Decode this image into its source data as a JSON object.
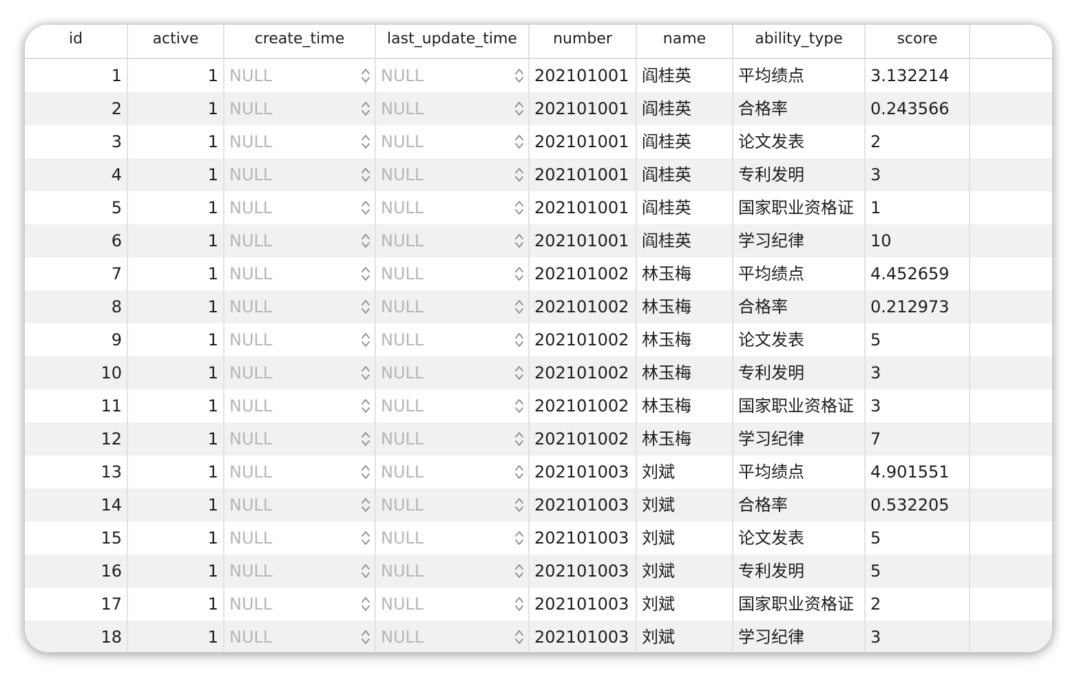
{
  "table": {
    "columns": [
      "id",
      "active",
      "create_time",
      "last_update_time",
      "number",
      "name",
      "ability_type",
      "score"
    ],
    "rows": [
      {
        "id": "1",
        "active": "1",
        "create_time": "NULL",
        "last_update_time": "NULL",
        "number": "202101001",
        "name": "阎桂英",
        "ability_type": "平均绩点",
        "score": "3.132214"
      },
      {
        "id": "2",
        "active": "1",
        "create_time": "NULL",
        "last_update_time": "NULL",
        "number": "202101001",
        "name": "阎桂英",
        "ability_type": "合格率",
        "score": "0.243566"
      },
      {
        "id": "3",
        "active": "1",
        "create_time": "NULL",
        "last_update_time": "NULL",
        "number": "202101001",
        "name": "阎桂英",
        "ability_type": "论文发表",
        "score": "2"
      },
      {
        "id": "4",
        "active": "1",
        "create_time": "NULL",
        "last_update_time": "NULL",
        "number": "202101001",
        "name": "阎桂英",
        "ability_type": "专利发明",
        "score": "3"
      },
      {
        "id": "5",
        "active": "1",
        "create_time": "NULL",
        "last_update_time": "NULL",
        "number": "202101001",
        "name": "阎桂英",
        "ability_type": "国家职业资格证",
        "score": "1"
      },
      {
        "id": "6",
        "active": "1",
        "create_time": "NULL",
        "last_update_time": "NULL",
        "number": "202101001",
        "name": "阎桂英",
        "ability_type": "学习纪律",
        "score": "10"
      },
      {
        "id": "7",
        "active": "1",
        "create_time": "NULL",
        "last_update_time": "NULL",
        "number": "202101002",
        "name": "林玉梅",
        "ability_type": "平均绩点",
        "score": "4.452659"
      },
      {
        "id": "8",
        "active": "1",
        "create_time": "NULL",
        "last_update_time": "NULL",
        "number": "202101002",
        "name": "林玉梅",
        "ability_type": "合格率",
        "score": "0.212973"
      },
      {
        "id": "9",
        "active": "1",
        "create_time": "NULL",
        "last_update_time": "NULL",
        "number": "202101002",
        "name": "林玉梅",
        "ability_type": "论文发表",
        "score": "5"
      },
      {
        "id": "10",
        "active": "1",
        "create_time": "NULL",
        "last_update_time": "NULL",
        "number": "202101002",
        "name": "林玉梅",
        "ability_type": "专利发明",
        "score": "3"
      },
      {
        "id": "11",
        "active": "1",
        "create_time": "NULL",
        "last_update_time": "NULL",
        "number": "202101002",
        "name": "林玉梅",
        "ability_type": "国家职业资格证",
        "score": "3"
      },
      {
        "id": "12",
        "active": "1",
        "create_time": "NULL",
        "last_update_time": "NULL",
        "number": "202101002",
        "name": "林玉梅",
        "ability_type": "学习纪律",
        "score": "7"
      },
      {
        "id": "13",
        "active": "1",
        "create_time": "NULL",
        "last_update_time": "NULL",
        "number": "202101003",
        "name": "刘斌",
        "ability_type": "平均绩点",
        "score": "4.901551"
      },
      {
        "id": "14",
        "active": "1",
        "create_time": "NULL",
        "last_update_time": "NULL",
        "number": "202101003",
        "name": "刘斌",
        "ability_type": "合格率",
        "score": "0.532205"
      },
      {
        "id": "15",
        "active": "1",
        "create_time": "NULL",
        "last_update_time": "NULL",
        "number": "202101003",
        "name": "刘斌",
        "ability_type": "论文发表",
        "score": "5"
      },
      {
        "id": "16",
        "active": "1",
        "create_time": "NULL",
        "last_update_time": "NULL",
        "number": "202101003",
        "name": "刘斌",
        "ability_type": "专利发明",
        "score": "5"
      },
      {
        "id": "17",
        "active": "1",
        "create_time": "NULL",
        "last_update_time": "NULL",
        "number": "202101003",
        "name": "刘斌",
        "ability_type": "国家职业资格证",
        "score": "2"
      },
      {
        "id": "18",
        "active": "1",
        "create_time": "NULL",
        "last_update_time": "NULL",
        "number": "202101003",
        "name": "刘斌",
        "ability_type": "学习纪律",
        "score": "3"
      }
    ]
  },
  "icons": {
    "cell_stepper": "up-down-chevron-icon"
  },
  "colors": {
    "null_text": "#b6b6b8",
    "alt_row": "#f1f1f2",
    "grid_line": "#e2e2e2"
  }
}
